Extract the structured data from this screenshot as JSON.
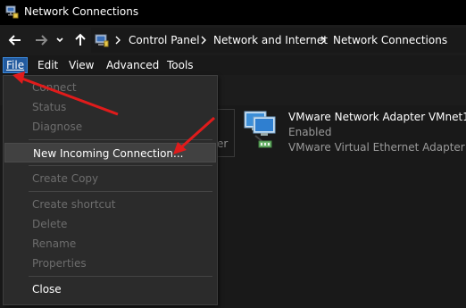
{
  "window": {
    "title": "Network Connections"
  },
  "address_bar": {
    "crumbs": [
      "Control Panel",
      "Network and Internet",
      "Network Connections"
    ]
  },
  "menu": {
    "file": "File",
    "edit": "Edit",
    "view": "View",
    "advanced": "Advanced",
    "tools": "Tools"
  },
  "file_menu": {
    "connect": "Connect",
    "status": "Status",
    "diagnose": "Diagnose",
    "new_incoming": "New Incoming Connection...",
    "create_copy": "Create Copy",
    "create_shortcut": "Create shortcut",
    "delete": "Delete",
    "rename": "Rename",
    "properties": "Properties",
    "close": "Close"
  },
  "adapter": {
    "name": "VMware Network Adapter VMnet1",
    "status": "Enabled",
    "device": "VMware Virtual Ethernet Adapter ..."
  },
  "partial_adapter_text": "er",
  "colors": {
    "background": "#191919",
    "menu_active": "#225a9e",
    "annotation_arrow": "#e01b1b"
  },
  "icons": {
    "back": "arrow-left-icon",
    "forward": "arrow-right-icon",
    "recent": "chevron-down-icon",
    "up": "arrow-up-icon",
    "address": "control-panel-icon",
    "adapter": "network-adapter-icon"
  }
}
